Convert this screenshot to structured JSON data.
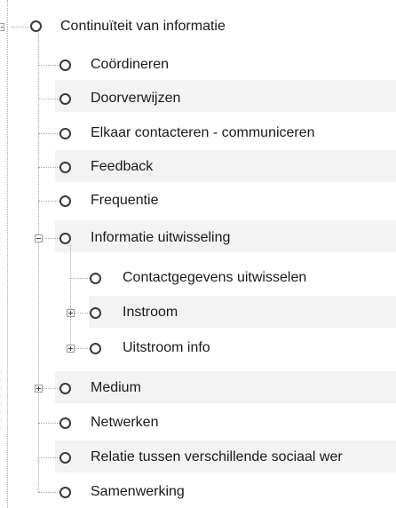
{
  "tree": {
    "root": {
      "label": "Continuïteit van informatie",
      "state": "expanded"
    },
    "children": [
      {
        "label": "Coördineren"
      },
      {
        "label": "Doorverwijzen"
      },
      {
        "label": "Elkaar contacteren - communiceren"
      },
      {
        "label": "Feedback"
      },
      {
        "label": "Frequentie"
      },
      {
        "label": "Informatie uitwisseling",
        "state": "expanded",
        "children": [
          {
            "label": "Contactgegevens uitwisselen"
          },
          {
            "label": "Instroom",
            "state": "collapsed"
          },
          {
            "label": "Uitstroom info",
            "state": "collapsed"
          }
        ]
      },
      {
        "label": "Medium",
        "state": "collapsed"
      },
      {
        "label": "Netwerken"
      },
      {
        "label": "Relatie tussen verschillende sociaal wer"
      },
      {
        "label": "Samenwerking"
      }
    ]
  }
}
